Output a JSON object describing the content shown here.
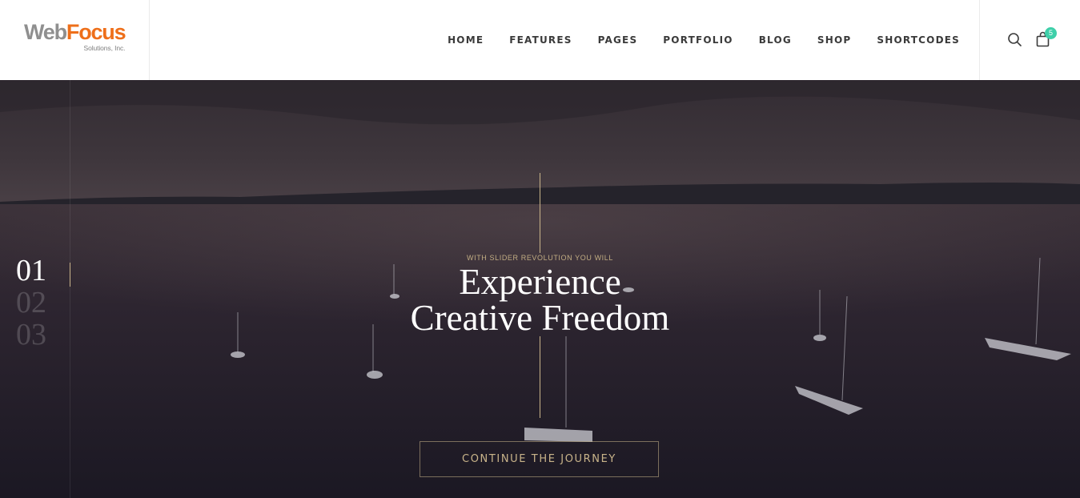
{
  "logo": {
    "part1": "Web",
    "part2": "Focus",
    "tagline": "Solutions, Inc."
  },
  "nav": {
    "items": [
      "HOME",
      "FEATURES",
      "PAGES",
      "PORTFOLIO",
      "BLOG",
      "SHOP",
      "SHORTCODES"
    ]
  },
  "icons": {
    "search": "search-icon",
    "cart": "shopping-bag-icon"
  },
  "cart": {
    "count": "5"
  },
  "slider": {
    "numbers": [
      "01",
      "02",
      "03"
    ],
    "active_index": 0,
    "eyebrow": "WITH SLIDER REVOLUTION YOU WILL",
    "headline_line1": "Experience",
    "headline_line2": "Creative Freedom",
    "cta_label": "CONTINUE THE JOURNEY"
  },
  "colors": {
    "accent_gold": "#c9b48a",
    "badge_green": "#3ecfa9",
    "logo_gray": "#8f8f8f",
    "logo_orange": "#ee6f1a",
    "nav_text": "#3a3a3a"
  }
}
